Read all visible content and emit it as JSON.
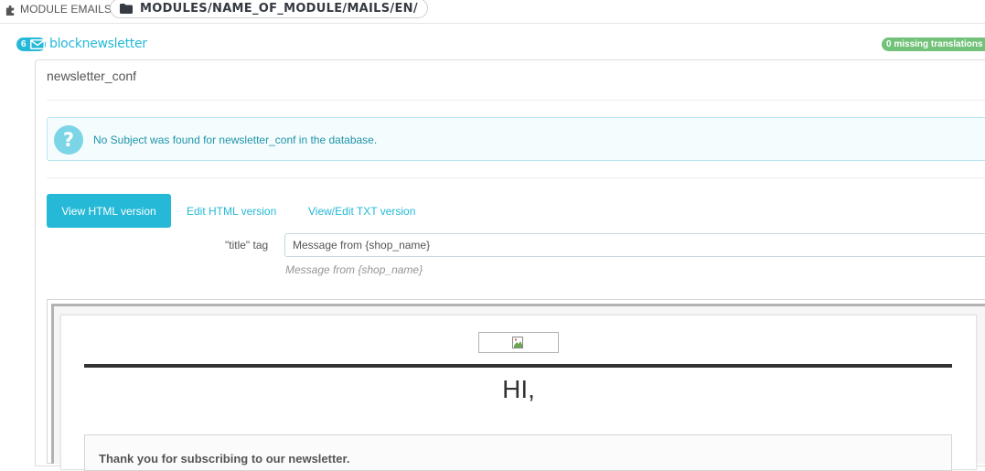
{
  "header": {
    "section_label": "MODULE EMAILS",
    "path": "MODULES/NAME_OF_MODULE/MAILS/EN/"
  },
  "module": {
    "count": "6",
    "name": "blocknewsletter",
    "missing_translations": "0 missing translations"
  },
  "mail": {
    "name": "newsletter_conf",
    "alert_text": "No Subject was found for newsletter_conf in the database."
  },
  "tabs": [
    {
      "label": "View HTML version",
      "active": true
    },
    {
      "label": "Edit HTML version",
      "active": false
    },
    {
      "label": "View/Edit TXT version",
      "active": false
    }
  ],
  "title_field": {
    "label": "\"title\" tag",
    "value": "Message from {shop_name}",
    "help": "Message from {shop_name}"
  },
  "preview": {
    "greeting": "HI,",
    "message": "Thank you for subscribing to our newsletter."
  },
  "colors": {
    "accent": "#25b9d7",
    "success": "#72c279",
    "alert_bg": "#f4fcfd"
  }
}
